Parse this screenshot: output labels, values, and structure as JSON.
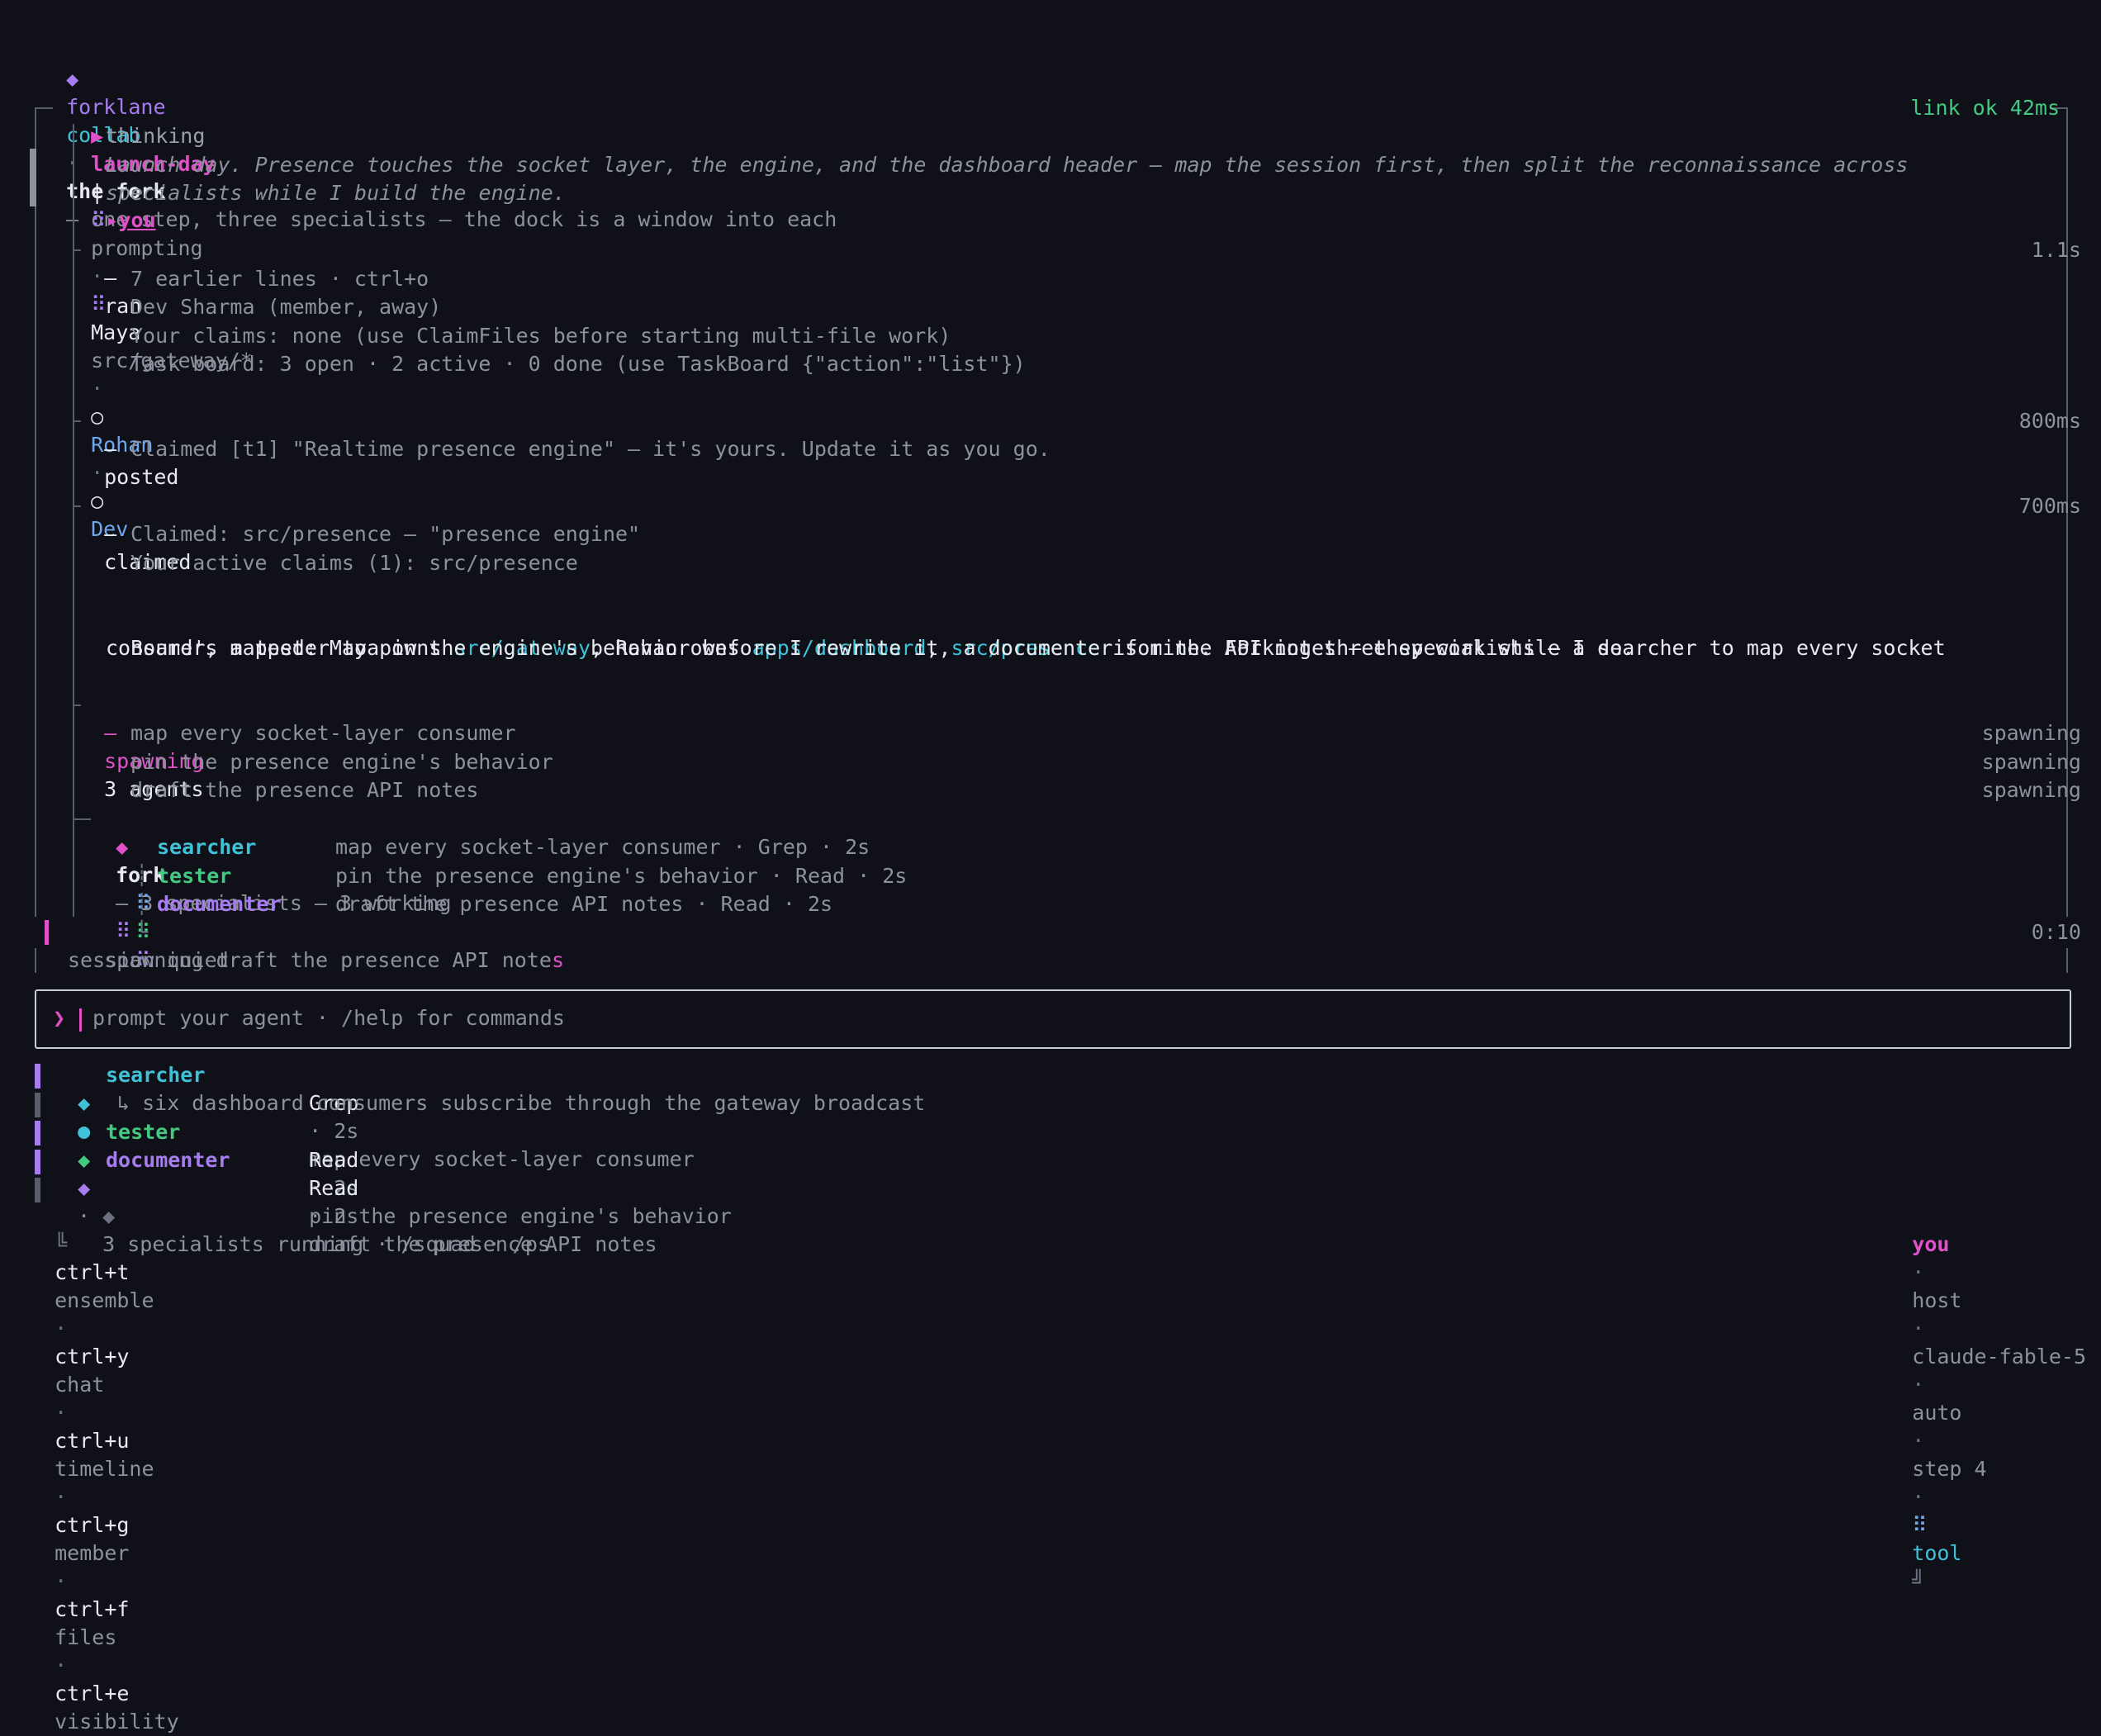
{
  "header": {
    "brand_glyph": "◆",
    "brand": "forklane",
    "product": "collab",
    "dot": "·",
    "title": "the fork",
    "subtitle": "— one step, three specialists — the dock is a window into each"
  },
  "session_bar": {
    "play_glyph": "▶",
    "session_name": "launch-day",
    "divider": "|",
    "busy_glyph": "⠿",
    "you_marker": "▸",
    "you_label": "you",
    "you_status": "prompting",
    "dot": "·",
    "maya_glyph": "⠿",
    "maya": "Maya",
    "maya_path": "src/gateway/*",
    "rohan_glyph": "○",
    "rohan": "Rohan",
    "dev_glyph": "○",
    "dev": "Dev",
    "link_status": "link ok 42ms"
  },
  "thinking": {
    "label": "thinking",
    "line1": "Launch day. Presence touches the socket layer, the engine, and the dashboard header — map the session first, then split the reconnaissance across",
    "line2": "specialists while I build the engine."
  },
  "ran": {
    "dash": "—",
    "label": "ran",
    "time": "1.1s",
    "lines": [
      "7 earlier lines · ctrl+o",
      "Dev Sharma (member, away)",
      "Your claims: none (use ClaimFiles before starting multi-file work)",
      "Task board: 3 open · 2 active · 0 done (use TaskBoard {\"action\":\"list\"})"
    ]
  },
  "posted": {
    "dash": "—",
    "label": "posted",
    "time": "800ms",
    "line": "Claimed [t1] \"Realtime presence engine\" — it's yours. Update it as you go."
  },
  "claimed": {
    "dash": "—",
    "label": "claimed",
    "time": "700ms",
    "lines": [
      "Claimed: src/presence — \"presence engine\"",
      "Your active claims (1): src/presence"
    ]
  },
  "message": {
    "p1": "Board's mapped: Maya owns ",
    "l1": "src/gateway",
    "p2": ", Rohan owns ",
    "l2": "apps/dashboard",
    "p3": ", ",
    "l3": "src/presence",
    "p4": " is mine. Forking three specialists — a searcher to map every socket",
    "line2": "consumer, a tester to pin the engine's behavior before I rewrite it, a documenter for the API notes — they work while I do."
  },
  "spawning": {
    "dash": "—",
    "label": "spawning",
    "count": "3 agents",
    "tasks": [
      {
        "text": "map every socket-layer consumer",
        "status": "spawning"
      },
      {
        "text": "pin the presence engine's behavior",
        "status": "spawning"
      },
      {
        "text": "draft the presence API notes",
        "status": "spawning"
      }
    ]
  },
  "fork": {
    "glyph": "◆",
    "label": "fork",
    "summary": "— 3 specialists — 3 working",
    "busy_glyph": "⠿",
    "agents": [
      {
        "branch": "┊",
        "glyph": "⠿",
        "name": "searcher",
        "detail": "map every socket-layer consumer · Grep · 2s"
      },
      {
        "branch": "┊",
        "glyph": "⠿",
        "name": "tester",
        "detail": "pin the presence engine's behavior · Read · 2s"
      },
      {
        "branch": "└",
        "glyph": "⠿",
        "name": "documenter",
        "detail": "draft the presence API notes · Read · 2s"
      }
    ]
  },
  "status": {
    "spawning_line": "spawning draft the presence API note",
    "spawning_last": "s",
    "timer": "0:10",
    "quiet": "session quiet"
  },
  "input": {
    "prompt_glyph": "❯",
    "placeholder": "prompt your agent · /help for commands"
  },
  "dock": {
    "agents": [
      {
        "glyph": "◆",
        "state": "●",
        "name": "searcher",
        "tool": "Grep",
        "time": "· 2s",
        "task": "map every socket-layer consumer"
      },
      {
        "glyph": "◆",
        "state": "·",
        "name": "tester",
        "tool": "Read",
        "time": "· 2s",
        "task": "pin the presence engine's behavior"
      },
      {
        "glyph": "◆",
        "state": "·",
        "name": "documenter",
        "tool": "Read",
        "time": "· 2s",
        "task": "draft the presence API notes"
      }
    ],
    "searcher_result": "↳ six dashboard consumers subscribe through the gateway broadcast",
    "summary_glyph": "◆",
    "summary": "3 specialists running · /squad · /ps"
  },
  "footer": {
    "corner": "╚",
    "shortcuts": [
      {
        "key": "ctrl+t",
        "label": "ensemble"
      },
      {
        "key": "ctrl+y",
        "label": "chat"
      },
      {
        "key": "ctrl+u",
        "label": "timeline"
      },
      {
        "key": "ctrl+g",
        "label": "member"
      },
      {
        "key": "ctrl+f",
        "label": "files"
      },
      {
        "key": "ctrl+e",
        "label": "visibility"
      }
    ],
    "dot": "·",
    "user": "you",
    "role": "host",
    "model": "claude-fable-5",
    "mode": "auto",
    "step": "step 4",
    "tool_glyph": "⠿",
    "tool": "tool",
    "end_corner": "╝"
  },
  "colors": {
    "background": "#0f1018",
    "accent_pink": "#e050c8",
    "accent_violet": "#a77cf0",
    "link_cyan": "#3fc2d8",
    "ok_green": "#44c982",
    "member_blue": "#6fa8ee"
  }
}
